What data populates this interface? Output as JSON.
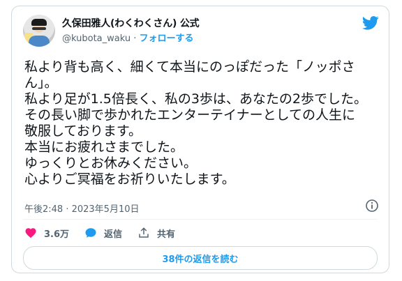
{
  "author": {
    "display_name": "久保田雅人(わくわくさん) 公式",
    "handle": "@kubota_waku",
    "separator": " · ",
    "follow_label": "フォローする"
  },
  "tweet": {
    "lines": [
      "私より背も高く、細くて本当にのっぽだった「ノッポさ",
      "ん」。",
      "私より足が1.5倍長く、私の3歩は、あなたの2歩でした。",
      "その長い脚で歩かれたエンターテイナーとしての人生に",
      "敬服しております。",
      "本当にお疲れさまでした。",
      "ゆっくりとお休みください。",
      "心よりご冥福をお祈りいたします。"
    ],
    "timestamp": "午後2:48 · 2023年5月10日"
  },
  "actions": {
    "likes": "3.6万",
    "reply_label": "返信",
    "share_label": "共有"
  },
  "read_replies_label": "38件の返信を読む",
  "colors": {
    "accent": "#1d9bf0",
    "like": "#f91880",
    "muted": "#536471"
  }
}
